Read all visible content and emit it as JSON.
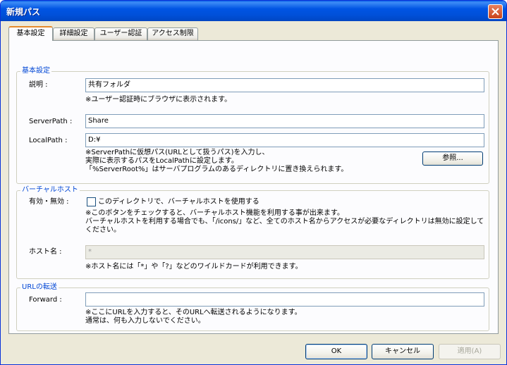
{
  "window": {
    "title": "新規パス"
  },
  "tabs": [
    {
      "label": "基本設定"
    },
    {
      "label": "詳細設定"
    },
    {
      "label": "ユーザー認証"
    },
    {
      "label": "アクセス制限"
    }
  ],
  "basic": {
    "group_title": "基本設定",
    "description_label": "説明 :",
    "description_value": "共有フォルダ",
    "description_note": "※ユーザー認証時にブラウザに表示されます。",
    "serverpath_label": "ServerPath :",
    "serverpath_value": "Share",
    "localpath_label": "LocalPath :",
    "localpath_value": "D:¥",
    "localpath_note1": "※ServerPathに仮想パス(URLとして扱うパス)を入力し、",
    "localpath_note2": "実際に表示するパスをLocalPathに設定します。",
    "localpath_note3": "「%ServerRoot%」はサーバプログラムのあるディレクトリに置き換えられます。",
    "browse_label": "参照..."
  },
  "virtualhost": {
    "group_title": "バーチャルホスト",
    "enable_label": "有効・無効 :",
    "checkbox_label": "このディレクトリで、バーチャルホストを使用する",
    "checkbox_checked": false,
    "note1": "※このボタンをチェックすると、バーチャルホスト機能を利用する事が出来ます。",
    "note2": "バーチャルホストを利用する場合でも、「/icons/」など、全てのホスト名からアクセスが必要なディレクトリは無効に設定して",
    "note3": "ください。",
    "hostname_label": "ホスト名 :",
    "hostname_value": "*",
    "hostname_note": "※ホスト名には「*」や「?」などのワイルドカードが利用できます。"
  },
  "forward": {
    "group_title": "URLの転送",
    "forward_label": "Forward :",
    "forward_value": "",
    "note1": "※ここにURLを入力すると、そのURLへ転送されるようになります。",
    "note2": "通常は、何も入力しないでください。"
  },
  "buttons": {
    "ok": "OK",
    "cancel": "キャンセル",
    "apply": "適用(A)"
  }
}
